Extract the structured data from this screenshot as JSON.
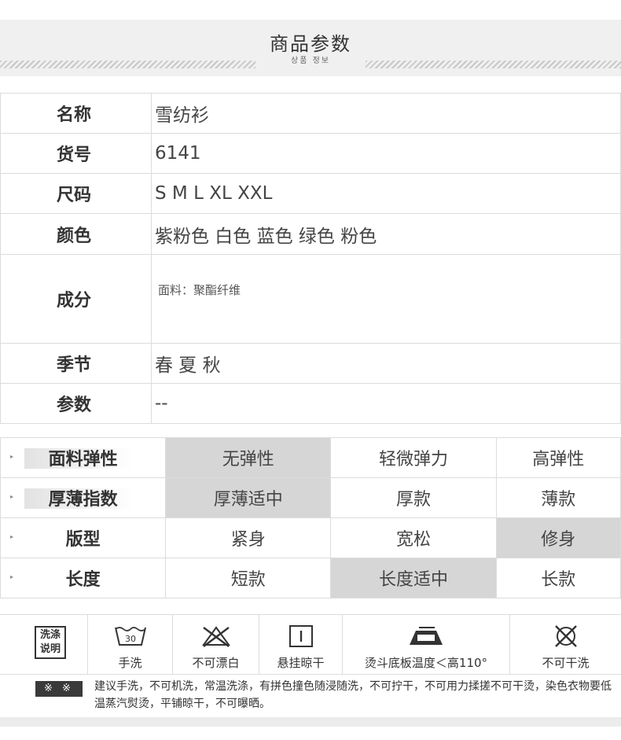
{
  "header": {
    "title": "商品参数",
    "subtitle": "상품 정보"
  },
  "info": {
    "rows": [
      {
        "key": "名称",
        "value": "雪纺衫"
      },
      {
        "key": "货号",
        "value": "6141"
      },
      {
        "key": "尺码",
        "value": "S M L XL XXL"
      },
      {
        "key": "颜色",
        "value": "紫粉色 白色 蓝色  绿色  粉色"
      },
      {
        "key": "成分",
        "value": "面料：聚酯纤维"
      },
      {
        "key": "季节",
        "value": "春 夏 秋"
      },
      {
        "key": "参数",
        "value": "--"
      }
    ]
  },
  "attributes": {
    "rows": [
      {
        "label": "面料弹性",
        "options": [
          "无弹性",
          "轻微弹力",
          "高弹性"
        ],
        "selected_index": 0
      },
      {
        "label": "厚薄指数",
        "options": [
          "厚薄适中",
          "厚款",
          "薄款"
        ],
        "selected_index": 0
      },
      {
        "label": "版型",
        "options": [
          "紧身",
          "宽松",
          "修身"
        ],
        "selected_index": 2
      },
      {
        "label": "长度",
        "options": [
          "短款",
          "长度适中",
          "长款"
        ],
        "selected_index": 1
      }
    ],
    "arrow_glyph": "▸"
  },
  "care": {
    "title_line1": "洗涤",
    "title_line2": "说明",
    "items": [
      {
        "icon": "hand-wash-30-icon",
        "label": "手洗",
        "temp": "30"
      },
      {
        "icon": "no-bleach-icon",
        "label": "不可漂白"
      },
      {
        "icon": "hang-dry-icon",
        "label": "悬挂晾干"
      },
      {
        "icon": "iron-icon",
        "label": "烫斗底板温度＜高110°"
      },
      {
        "icon": "no-dry-clean-icon",
        "label": "不可干洗"
      }
    ],
    "note_badge": "※ ※",
    "note_text": "建议手洗，不可机洗，常温洗涤，有拼色撞色随浸随洗，不可拧干，不可用力揉搓不可干烫，染色衣物要低温蒸汽熨烫，平铺晾干，不可曝晒。"
  },
  "colors": {
    "selected_bg": "#d6d6d6",
    "border": "#dcdcdc",
    "header_bg": "#f0f0f0"
  }
}
